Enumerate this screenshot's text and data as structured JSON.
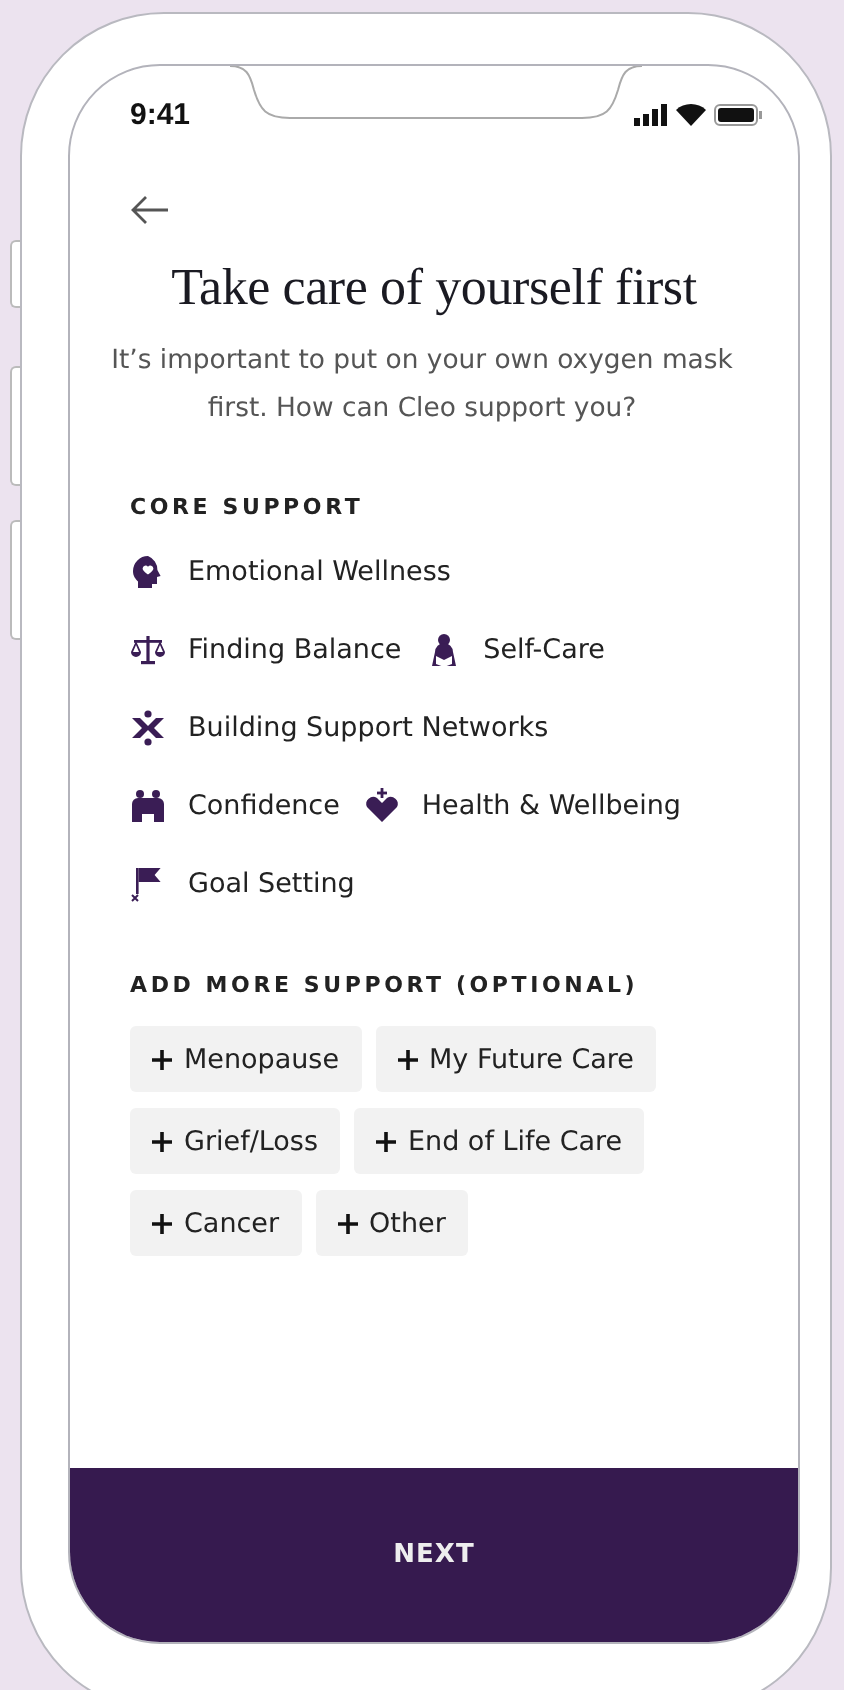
{
  "status_bar": {
    "time": "9:41"
  },
  "title": "Take care of yourself first",
  "subtitle": "It’s important to put on your own oxygen mask first. How can Cleo support you?",
  "core_support": {
    "heading": "CORE SUPPORT",
    "rows": [
      [
        {
          "label": "Emotional Wellness"
        }
      ],
      [
        {
          "label": "Finding Balance"
        },
        {
          "label": "Self-Care"
        }
      ],
      [
        {
          "label": "Building Support Networks"
        }
      ],
      [
        {
          "label": "Confidence"
        },
        {
          "label": "Health & Wellbeing"
        }
      ],
      [
        {
          "label": "Goal Setting"
        }
      ]
    ]
  },
  "optional_support": {
    "heading": "ADD MORE SUPPORT (OPTIONAL)",
    "rows": [
      [
        {
          "label": "Menopause"
        },
        {
          "label": "My Future Care"
        }
      ],
      [
        {
          "label": "Grief/Loss"
        },
        {
          "label": "End of Life Care"
        }
      ],
      [
        {
          "label": "Cancer"
        },
        {
          "label": "Other"
        }
      ]
    ]
  },
  "next_button": "NEXT"
}
